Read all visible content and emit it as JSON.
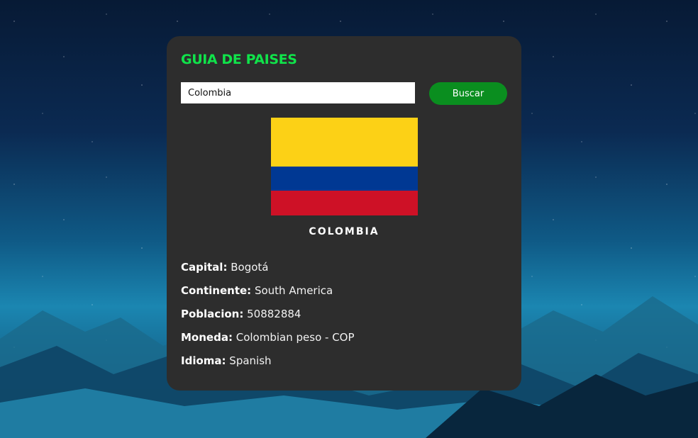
{
  "app": {
    "title": "GUIA DE PAISES"
  },
  "search": {
    "value": "Colombia",
    "placeholder": "",
    "button_label": "Buscar"
  },
  "country": {
    "name": "COLOMBIA",
    "flag": {
      "colors": [
        "#fcd116",
        "#003893",
        "#ce1126"
      ]
    },
    "details": [
      {
        "label": "Capital:",
        "value": "Bogotá"
      },
      {
        "label": "Continente:",
        "value": "South America"
      },
      {
        "label": "Poblacion:",
        "value": "50882884"
      },
      {
        "label": "Moneda:",
        "value": "Colombian peso - COP"
      },
      {
        "label": "Idioma:",
        "value": "Spanish"
      }
    ]
  },
  "theme": {
    "accent": "#10e34a",
    "button": "#0a8e1f",
    "card": "#2d2d2d"
  }
}
